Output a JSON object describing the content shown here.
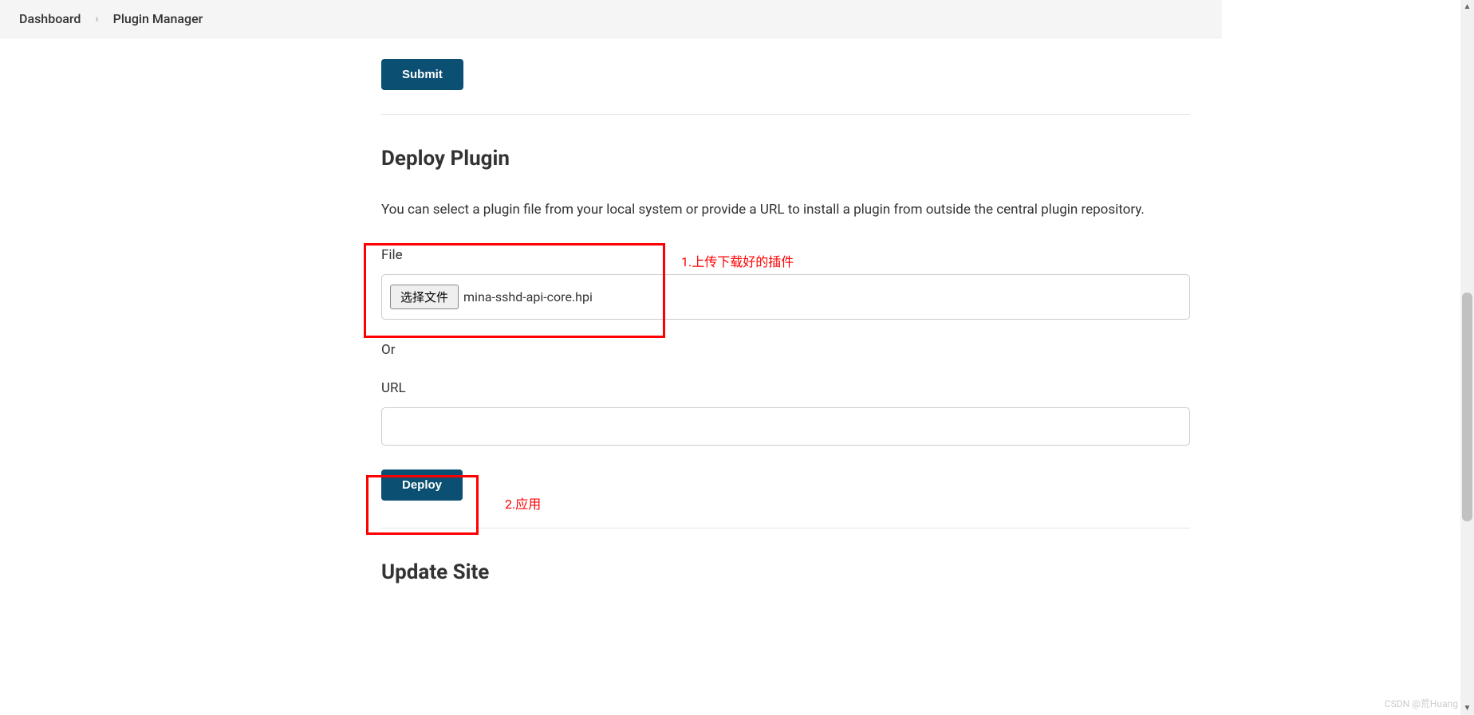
{
  "breadcrumb": {
    "items": [
      "Dashboard",
      "Plugin Manager"
    ]
  },
  "submit_button": "Submit",
  "deploy_section": {
    "heading": "Deploy Plugin",
    "description": "You can select a plugin file from your local system or provide a URL to install a plugin from outside the central plugin repository.",
    "file_label": "File",
    "choose_file_button": "选择文件",
    "selected_file": "mina-sshd-api-core.hpi",
    "or_label": "Or",
    "url_label": "URL",
    "url_value": "",
    "deploy_button": "Deploy"
  },
  "update_section": {
    "heading": "Update Site"
  },
  "annotations": {
    "note1": "1.上传下载好的插件",
    "note2": "2.应用"
  },
  "watermark": "CSDN @荒Huang"
}
